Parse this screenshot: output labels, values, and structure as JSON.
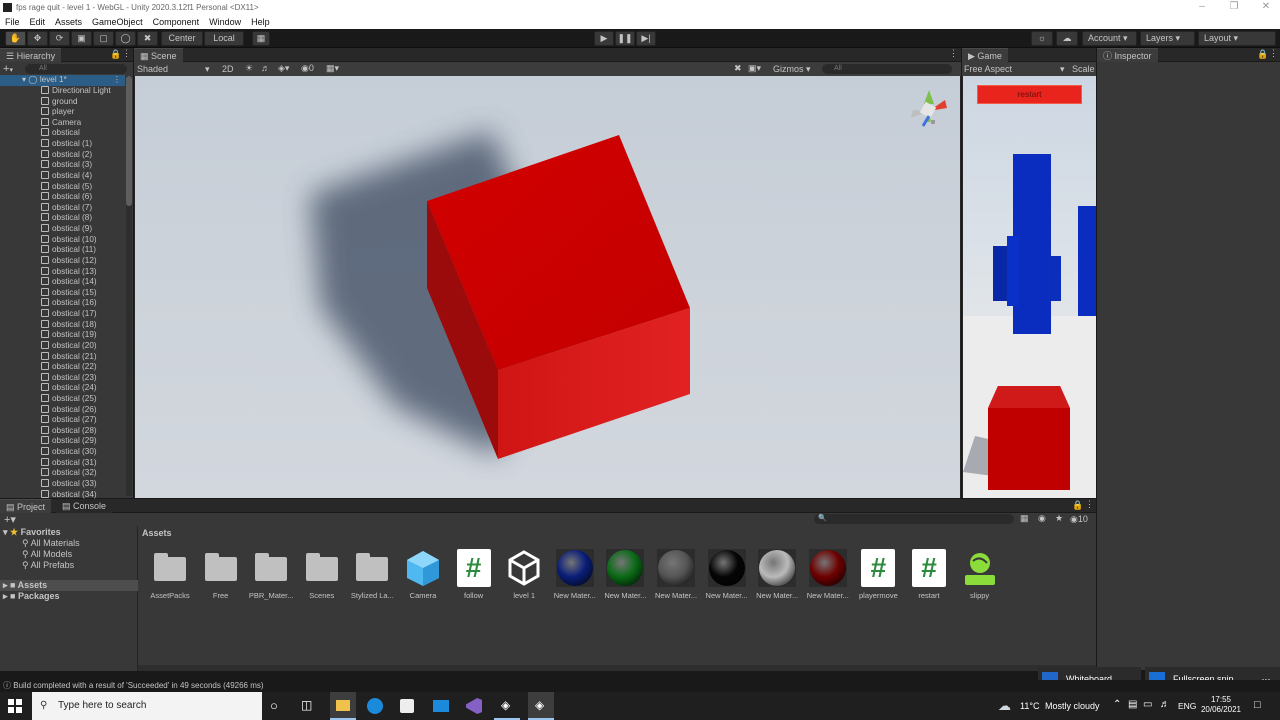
{
  "window": {
    "title": "fps rage quit - level 1 - WebGL - Unity 2020.3.12f1 Personal <DX11>"
  },
  "menu": [
    "File",
    "Edit",
    "Assets",
    "GameObject",
    "Component",
    "Window",
    "Help"
  ],
  "toolbar": {
    "center_label": "Center",
    "local_label": "Local",
    "account_label": "Account",
    "layers_label": "Layers",
    "layout_label": "Layout"
  },
  "hierarchy": {
    "tab_label": "Hierarchy",
    "search_placeholder": "All",
    "scene_name": "level 1*",
    "items": [
      "Directional Light",
      "ground",
      "player",
      "Camera",
      "obstical",
      "obstical (1)",
      "obstical (2)",
      "obstical (3)",
      "obstical (4)",
      "obstical (5)",
      "obstical (6)",
      "obstical (7)",
      "obstical (8)",
      "obstical (9)",
      "obstical (10)",
      "obstical (11)",
      "obstical (12)",
      "obstical (13)",
      "obstical (14)",
      "obstical (15)",
      "obstical (16)",
      "obstical (17)",
      "obstical (18)",
      "obstical (19)",
      "obstical (20)",
      "obstical (21)",
      "obstical (22)",
      "obstical (23)",
      "obstical (24)",
      "obstical (25)",
      "obstical (26)",
      "obstical (27)",
      "obstical (28)",
      "obstical (29)",
      "obstical (30)",
      "obstical (31)",
      "obstical (32)",
      "obstical (33)",
      "obstical (34)"
    ]
  },
  "scene": {
    "tab_label": "Scene",
    "shading": "Shaded",
    "mode_2d": "2D",
    "layers_count": "0",
    "gizmos_label": "Gizmos",
    "search_placeholder": "All"
  },
  "game": {
    "tab_label": "Game",
    "aspect": "Free Aspect",
    "scale_label": "Scale",
    "restart_label": "restart"
  },
  "inspector": {
    "tab_label": "Inspector"
  },
  "project": {
    "tab_label": "Project",
    "console_label": "Console",
    "favorites_label": "Favorites",
    "favorites": [
      "All Materials",
      "All Models",
      "All Prefabs"
    ],
    "tree": [
      "Assets",
      "Packages"
    ],
    "breadcrumb": "Assets",
    "hidden_count": "10",
    "assets": [
      "AssetPacks",
      "Free",
      "PBR_Mater...",
      "Scenes",
      "Stylized La...",
      "Camera",
      "follow",
      "level 1",
      "New Mater...",
      "New Mater...",
      "New Mater...",
      "New Mater...",
      "New Mater...",
      "New Mater...",
      "playermove",
      "restart",
      "slippy"
    ]
  },
  "status": {
    "message": "Build completed with a result of 'Succeeded' in 49 seconds (49266 ms)"
  },
  "notifications": {
    "whiteboard": "Whiteboard",
    "snip": "Fullscreen snip"
  },
  "taskbar": {
    "search_placeholder": "Type here to search",
    "weather_temp": "11°C",
    "weather_desc": "Mostly cloudy",
    "language": "ENG",
    "time": "17:55",
    "date": "20/06/2021"
  },
  "colors": {
    "cube_red": "#c40000",
    "obstacle_blue": "#0a2dbf",
    "restart_button": "#e8241c",
    "editor_bg": "#383838"
  }
}
